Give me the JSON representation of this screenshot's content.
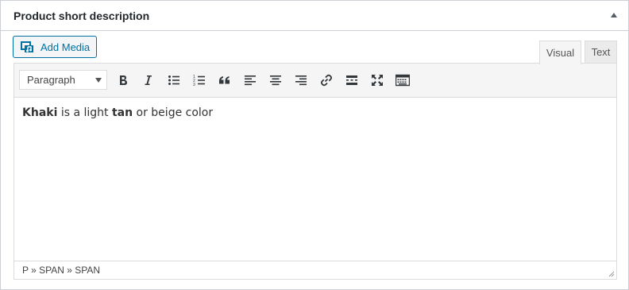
{
  "box": {
    "title": "Product short description"
  },
  "media": {
    "add_label": "Add Media"
  },
  "tabs": {
    "visual": "Visual",
    "text": "Text"
  },
  "toolbar": {
    "format_value": "Paragraph",
    "buttons": [
      "bold-icon",
      "italic-icon",
      "bullet-list-icon",
      "numbered-list-icon",
      "blockquote-icon",
      "align-left-icon",
      "align-center-icon",
      "align-right-icon",
      "link-icon",
      "read-more-icon",
      "fullscreen-icon",
      "toolbar-toggle-icon"
    ]
  },
  "content": {
    "word1": "Khaki",
    "mid1": " is a light ",
    "word2": "tan",
    "mid2": " or beige color"
  },
  "status": {
    "path": "P » SPAN » SPAN"
  },
  "colors": {
    "accent": "#0071a1",
    "border": "#dcdcde",
    "toolbar_bg": "#f5f5f5"
  }
}
